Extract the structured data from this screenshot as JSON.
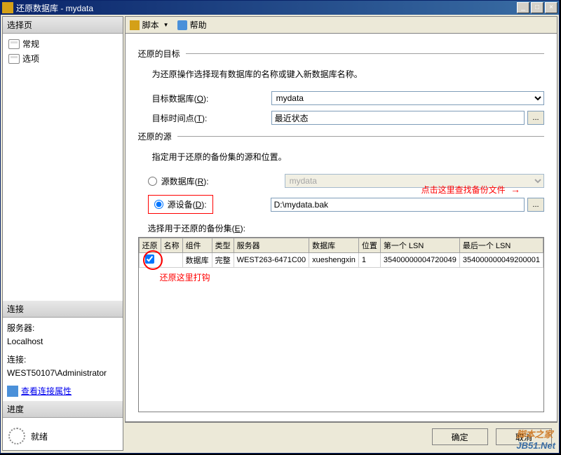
{
  "window": {
    "title": "还原数据库 - mydata",
    "min": "_",
    "max": "□",
    "close": "×"
  },
  "left": {
    "select_page": "选择页",
    "items": [
      "常规",
      "选项"
    ],
    "connection_header": "连接",
    "server_label": "服务器:",
    "server_value": "Localhost",
    "conn_label": "连接:",
    "conn_value": "WEST50107\\Administrator",
    "view_props": "查看连接属性",
    "progress_header": "进度",
    "progress_status": "就绪"
  },
  "toolbar": {
    "script": "脚本",
    "help": "帮助"
  },
  "target": {
    "section": "还原的目标",
    "desc": "为还原操作选择现有数据库的名称或键入新数据库名称。",
    "db_label": "目标数据库(O):",
    "db_value": "mydata",
    "time_label": "目标时间点(T):",
    "time_value": "最近状态",
    "browse": "..."
  },
  "source": {
    "section": "还原的源",
    "desc": "指定用于还原的备份集的源和位置。",
    "from_db_label": "源数据库(R):",
    "from_db_value": "mydata",
    "from_device_label": "源设备(D):",
    "device_path": "D:\\mydata.bak",
    "browse": "...",
    "annotation_find": "点击这里查找备份文件",
    "sets_label": "选择用于还原的备份集(E):"
  },
  "table": {
    "headers": [
      "还原",
      "名称",
      "组件",
      "类型",
      "服务器",
      "数据库",
      "位置",
      "第一个 LSN",
      "最后一个 LSN"
    ],
    "row": {
      "restore": true,
      "name": "",
      "component": "数据库",
      "type": "完整",
      "server": "WEST263-6471C00",
      "database": "xueshengxin",
      "position": "1",
      "first_lsn": "35400000004720049",
      "last_lsn": "354000000049200001"
    },
    "annotation_check": "还原这里打钩"
  },
  "buttons": {
    "ok": "确定",
    "cancel": "取消"
  },
  "watermark": {
    "cn": "脚本之家",
    "url": "JB51.Net"
  }
}
